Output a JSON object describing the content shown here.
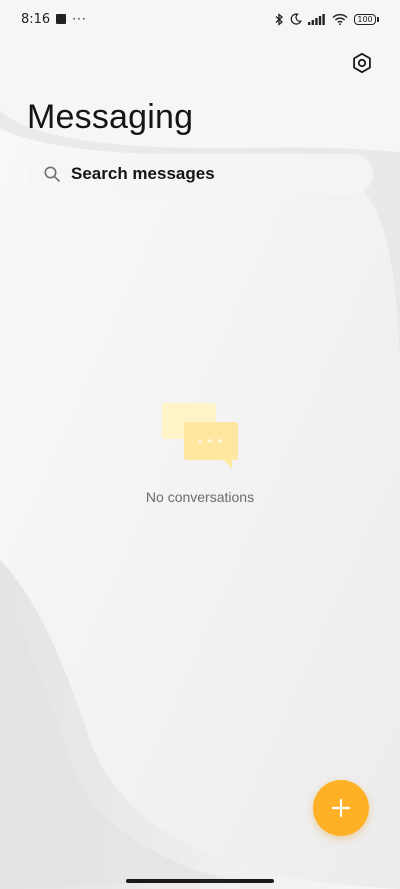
{
  "status_bar": {
    "time": "8:16",
    "overflow_dots": "···",
    "battery_level": "100"
  },
  "header": {
    "title": "Messaging"
  },
  "search": {
    "placeholder": "Search messages"
  },
  "empty_state": {
    "message": "No conversations"
  },
  "colors": {
    "accent": "#ffb125",
    "illustration_light": "#fff3c8",
    "illustration_dark": "#ffe7a0"
  },
  "icons": {
    "settings": "gear-icon",
    "search": "search-icon",
    "new_message": "plus-icon",
    "empty": "chat-bubbles-icon"
  }
}
